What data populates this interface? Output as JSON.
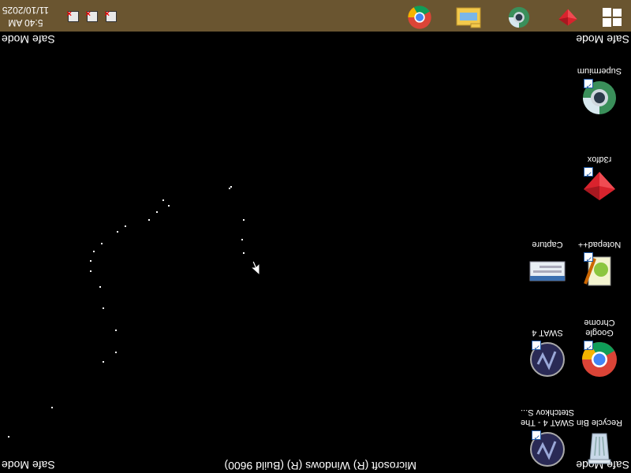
{
  "desktop": {
    "safe_mode_label": "Safe Mode",
    "build_text": "Microsoft (R) Windows (R) (Build 9600)",
    "icons": [
      {
        "label": "Recycle Bin",
        "icon": "recycle-bin-icon"
      },
      {
        "label": "SWAT 4 - The Stetchkov S...",
        "icon": "swat4-icon"
      },
      {
        "label": "Google Chrome",
        "icon": "chrome-icon"
      },
      {
        "label": "SWAT 4",
        "icon": "swat4-icon"
      },
      {
        "label": "Notepad++",
        "icon": "notepadpp-icon"
      },
      {
        "label": "Capture",
        "icon": "capture-icon"
      },
      {
        "label": "r3dfox",
        "icon": "r3dfox-icon"
      },
      {
        "label": "Supermium",
        "icon": "supermium-icon"
      }
    ]
  },
  "taskbar": {
    "start_icon": "windows-logo-icon",
    "pinned": [
      {
        "icon": "r3dfox-icon"
      },
      {
        "icon": "supermium-icon"
      },
      {
        "icon": "file-explorer-icon"
      },
      {
        "icon": "chrome-icon"
      }
    ],
    "tray": [
      {
        "icon": "network-error-icon"
      },
      {
        "icon": "volume-error-icon"
      },
      {
        "icon": "action-center-error-icon"
      }
    ],
    "clock": {
      "time": "5:40 AM",
      "date": "11/10/2025"
    }
  },
  "colors": {
    "taskbar": "#6a5530",
    "desktop": "#000000"
  }
}
